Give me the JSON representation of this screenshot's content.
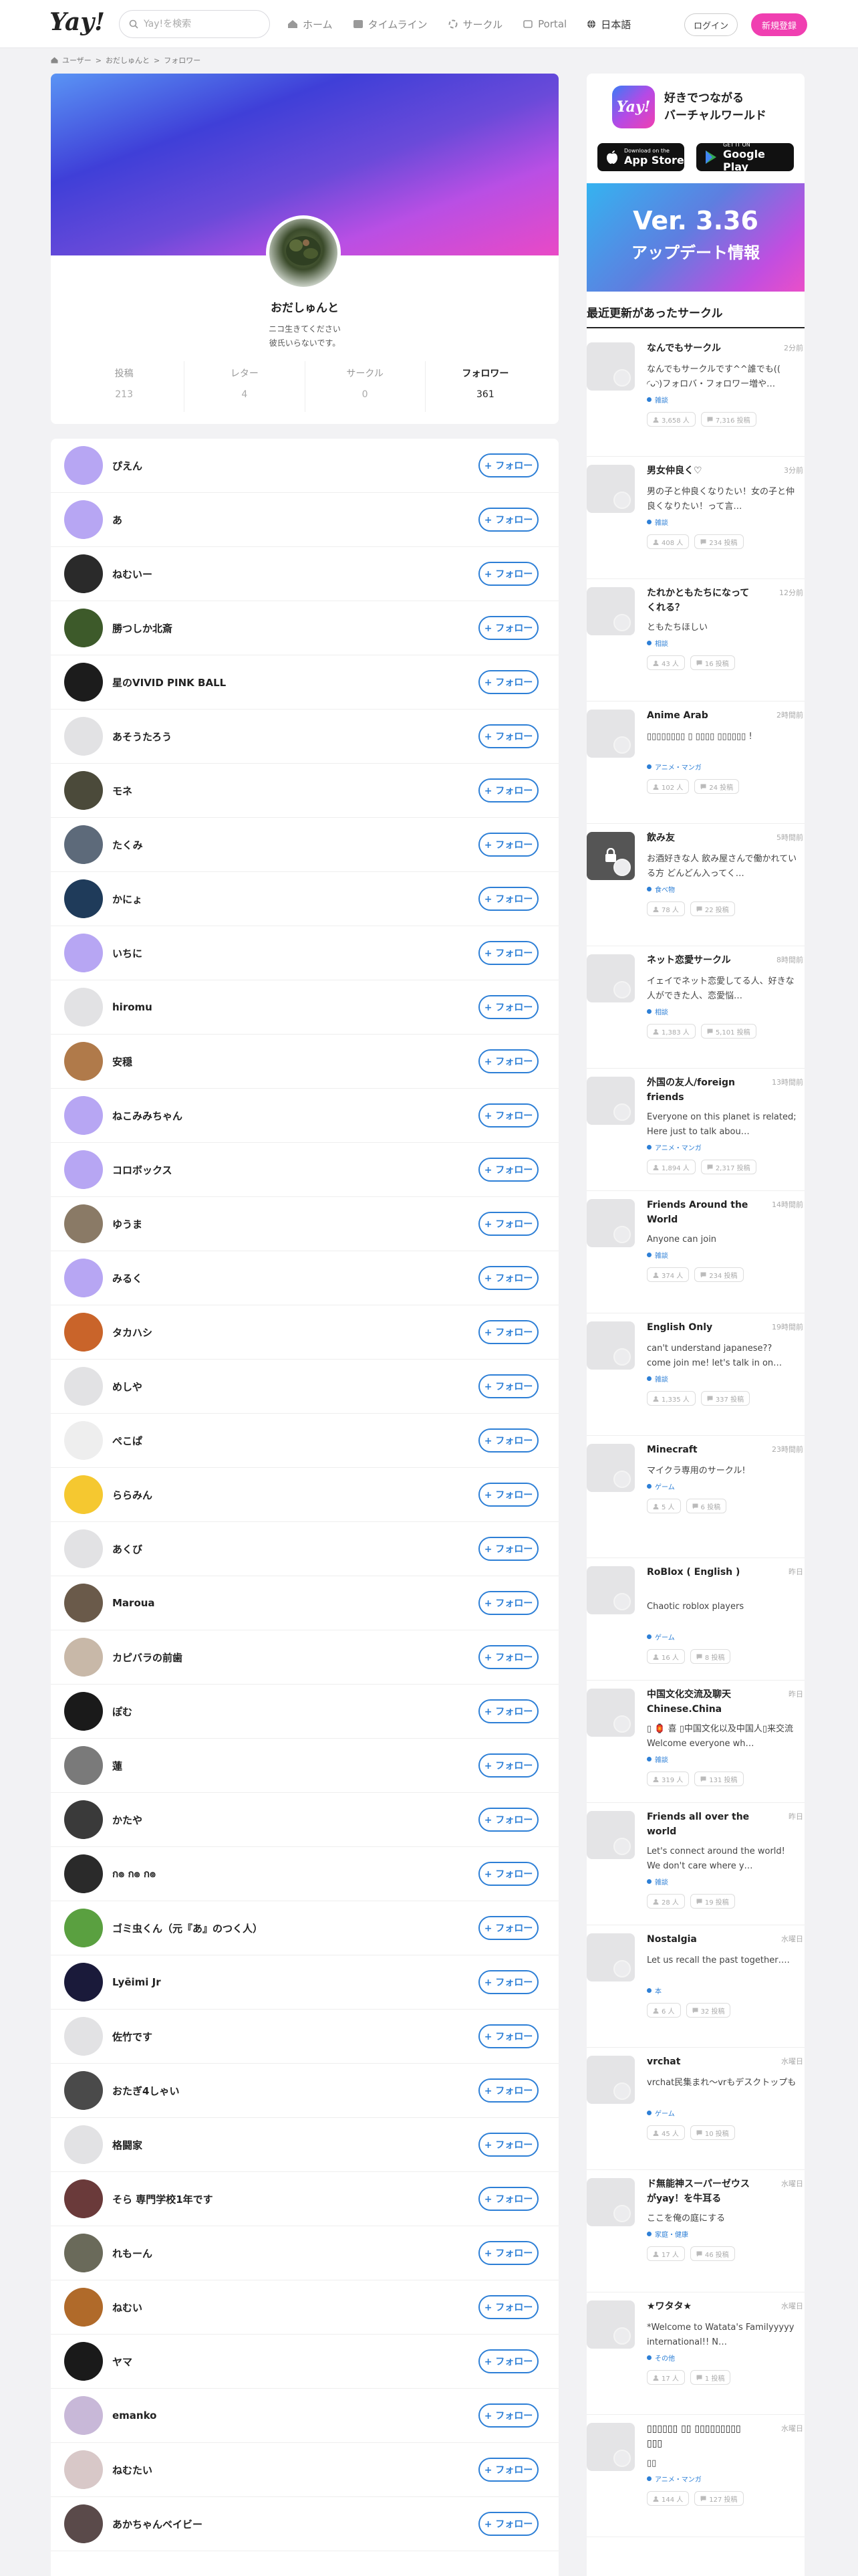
{
  "header": {
    "logo": "Yay!",
    "search_placeholder": "Yay!を検索",
    "nav": [
      {
        "label": "ホーム",
        "icon": "home-icon"
      },
      {
        "label": "タイムライン",
        "icon": "timeline-icon"
      },
      {
        "label": "サークル",
        "icon": "circle-icon"
      },
      {
        "label": "Portal",
        "icon": "portal-icon"
      },
      {
        "label": "日本語",
        "icon": "globe-icon"
      }
    ],
    "login": "ログイン",
    "signup": "新規登録"
  },
  "breadcrumb": [
    "ユーザー",
    "おだしゅんと",
    "フォロワー"
  ],
  "profile": {
    "name": "おだしゅんと",
    "bio_line1": "ニコ生きてください",
    "bio_line2": "彼氏いらないです。",
    "stats": [
      {
        "label": "投稿",
        "value": "213"
      },
      {
        "label": "レター",
        "value": "4"
      },
      {
        "label": "サークル",
        "value": "0"
      },
      {
        "label": "フォロワー",
        "value": "361"
      }
    ]
  },
  "follow_label": "+ フォロー",
  "followers": [
    {
      "name": "ぴえん",
      "avatar": "#b7a6f3"
    },
    {
      "name": "あ",
      "avatar": "#b7a6f3"
    },
    {
      "name": "ねむいー",
      "avatar": "#2a2a2a"
    },
    {
      "name": "勝つしか北斎",
      "avatar": "#3d5a2a"
    },
    {
      "name": "星のVIVID PINK BALL",
      "avatar": "#1c1c1c"
    },
    {
      "name": "あそうたろう",
      "avatar": "#e2e2e4"
    },
    {
      "name": "モネ",
      "avatar": "#4b4a3a"
    },
    {
      "name": "たくみ",
      "avatar": "#5d6a7a"
    },
    {
      "name": "かにょ",
      "avatar": "#1f3b5a"
    },
    {
      "name": "いちに",
      "avatar": "#b7a6f3"
    },
    {
      "name": "hiromu",
      "avatar": "#e2e2e4"
    },
    {
      "name": "安穏",
      "avatar": "#b07a4a"
    },
    {
      "name": "ねこみみちゃん",
      "avatar": "#b7a6f3"
    },
    {
      "name": "コロボックス",
      "avatar": "#b7a6f3"
    },
    {
      "name": "ゆうま",
      "avatar": "#8a7a66"
    },
    {
      "name": "みるく",
      "avatar": "#b7a6f3"
    },
    {
      "name": "タカハシ",
      "avatar": "#c9642a"
    },
    {
      "name": "めしや",
      "avatar": "#e2e2e4"
    },
    {
      "name": "ぺこぱ",
      "avatar": "#eeeeee"
    },
    {
      "name": "ららみん",
      "avatar": "#f5c830"
    },
    {
      "name": "あくび",
      "avatar": "#e2e2e4"
    },
    {
      "name": "Maroua",
      "avatar": "#6a5a4a"
    },
    {
      "name": "カピバラの前歯",
      "avatar": "#c8b8a8"
    },
    {
      "name": "ぽむ",
      "avatar": "#1a1a1a"
    },
    {
      "name": "蓮",
      "avatar": "#7a7a7a"
    },
    {
      "name": "かたや",
      "avatar": "#3a3a3a"
    },
    {
      "name": "ก๏ ก๏ ก๏",
      "avatar": "#2a2a2a"
    },
    {
      "name": "ゴミ虫くん（元『あ』のつく人）",
      "avatar": "#5aa040"
    },
    {
      "name": "Lyēimi Jr",
      "avatar": "#1a1a3a"
    },
    {
      "name": "佐竹です",
      "avatar": "#e2e2e4"
    },
    {
      "name": "おたぎ4しゃい",
      "avatar": "#4a4a4a"
    },
    {
      "name": "格闘家",
      "avatar": "#e2e2e4"
    },
    {
      "name": "そら 専門学校1年です",
      "avatar": "#6a3a3a"
    },
    {
      "name": "れもーん",
      "avatar": "#6a6a5a"
    },
    {
      "name": "ねむい",
      "avatar": "#b06a2a"
    },
    {
      "name": "ヤマ",
      "avatar": "#1a1a1a"
    },
    {
      "name": "emanko",
      "avatar": "#c8b8d8"
    },
    {
      "name": "ねむたい",
      "avatar": "#d8c8c8"
    },
    {
      "name": "あかちゃんベイビー",
      "avatar": "#5a4a4a"
    }
  ],
  "sidebar": {
    "promo_line1": "好きでつながる",
    "promo_line2": "バーチャルワールド",
    "appstore_small": "Download on the",
    "appstore_big": "App Store",
    "googleplay_small": "GET IT ON",
    "googleplay_big": "Google Play",
    "banner_version": "Ver. 3.36",
    "banner_text": "アップデート情報",
    "section_title": "最近更新があったサークル",
    "circles": [
      {
        "name": "なんでもサークル",
        "time": "2分前",
        "desc": "なんでもサークルです^^誰でも(( ◜ᴗ◝)フォロバ・フォロワー増や…",
        "tag": "雑談",
        "members": "3,658 人",
        "posts": "7,316 投稿"
      },
      {
        "name": "男女仲良く♡",
        "time": "3分前",
        "desc": "男の子と仲良くなりたい！女の子と仲良くなりたい！って言…",
        "tag": "雑談",
        "members": "408 人",
        "posts": "234 投稿"
      },
      {
        "name": "たれかともたちになってくれる？",
        "time": "12分前",
        "desc": "ともたちほしい",
        "tag": "相談",
        "members": "43 人",
        "posts": "16 投稿"
      },
      {
        "name": "Anime Arab",
        "time": "2時間前",
        "desc": "▯▯▯▯▯▯▯▯ ▯ ▯▯▯▯ ▯▯▯▯▯▯ !",
        "tag": "アニメ・マンガ",
        "members": "102 人",
        "posts": "24 投稿"
      },
      {
        "name": "飲み友",
        "time": "5時間前",
        "desc": "お酒好きな人 飲み屋さんで働かれている方 どんどん入ってく…",
        "tag": "食べ物",
        "members": "78 人",
        "posts": "22 投稿"
      },
      {
        "name": "ネット恋愛サークル",
        "time": "8時間前",
        "desc": "イェイでネット恋愛してる人、好きな人ができた人、恋愛悩…",
        "tag": "相談",
        "members": "1,383 人",
        "posts": "5,101 投稿"
      },
      {
        "name": "外国の友人/foreign friends",
        "time": "13時間前",
        "desc": "Everyone on this planet is related; Here just to talk abou…",
        "tag": "アニメ・マンガ",
        "members": "1,894 人",
        "posts": "2,317 投稿"
      },
      {
        "name": "Friends Around the World",
        "time": "14時間前",
        "desc": "Anyone can join",
        "tag": "雑談",
        "members": "374 人",
        "posts": "234 投稿"
      },
      {
        "name": "English Only",
        "time": "19時間前",
        "desc": "can't understand japanese?? come join me! let's talk in on…",
        "tag": "雑談",
        "members": "1,335 人",
        "posts": "337 投稿"
      },
      {
        "name": "Minecraft",
        "time": "23時間前",
        "desc": "マイクラ専用のサークル!",
        "tag": "ゲーム",
        "members": "5 人",
        "posts": "6 投稿"
      },
      {
        "name": "RoBlox ( English )",
        "time": "昨日",
        "desc": "Chaotic roblox players",
        "tag": "ゲーム",
        "members": "16 人",
        "posts": "8 投稿"
      },
      {
        "name": "中国文化交流及聊天Chinese.China",
        "time": "昨日",
        "desc": "▯ 🏮 喜 ▯中国文化以及中国人▯来交流 Welcome everyone wh…",
        "tag": "雑談",
        "members": "319 人",
        "posts": "131 投稿"
      },
      {
        "name": "Friends all over the world",
        "time": "昨日",
        "desc": "Let's connect around the world! We don't care where y…",
        "tag": "雑談",
        "members": "28 人",
        "posts": "19 投稿"
      },
      {
        "name": "Nostalgia",
        "time": "水曜日",
        "desc": "Let us recall the past together….",
        "tag": "本",
        "members": "6 人",
        "posts": "32 投稿"
      },
      {
        "name": "vrchat",
        "time": "水曜日",
        "desc": "vrchat民集まれ〜vrもデスクトップも",
        "tag": "ゲーム",
        "members": "45 人",
        "posts": "10 投稿"
      },
      {
        "name": "ド無能神スーパーゼウスがyay！を牛耳る",
        "time": "水曜日",
        "desc": "ここを俺の庭にする",
        "tag": "家庭・健康",
        "members": "17 人",
        "posts": "46 投稿"
      },
      {
        "name": "★ワタタ★",
        "time": "水曜日",
        "desc": "*Welcome to Watata's Familyyyyy international!! N…",
        "tag": "その他",
        "members": "17 人",
        "posts": "1 投稿"
      },
      {
        "name": "▯▯▯▯▯▯ ▯▯ ▯▯▯▯▯▯▯▯▯ ▯▯▯",
        "time": "水曜日",
        "desc": "▯▯",
        "tag": "アニメ・マンガ",
        "members": "144 人",
        "posts": "127 投稿"
      }
    ]
  }
}
